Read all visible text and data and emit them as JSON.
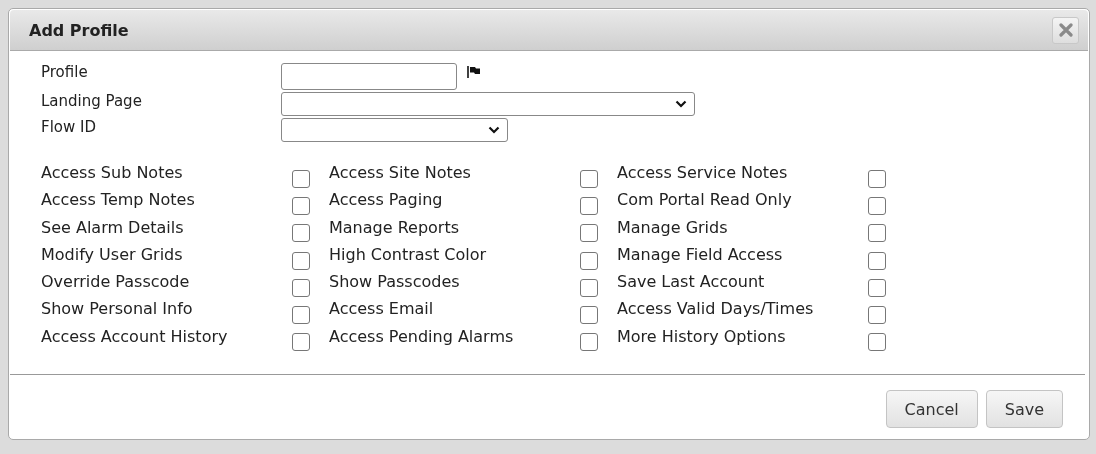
{
  "dialog": {
    "title": "Add Profile"
  },
  "fields": [
    {
      "label": "Profile",
      "kind": "text",
      "flag": true
    },
    {
      "label": "Landing Page",
      "kind": "select"
    },
    {
      "label": "Flow ID",
      "kind": "select"
    }
  ],
  "permissions": [
    {
      "label": "Access Sub Notes",
      "checked": false
    },
    {
      "label": "Access Site Notes",
      "checked": false
    },
    {
      "label": "Access Service Notes",
      "checked": false
    },
    {
      "label": "Access Temp Notes",
      "checked": false
    },
    {
      "label": "Access Paging",
      "checked": false
    },
    {
      "label": "Com Portal Read Only",
      "checked": false
    },
    {
      "label": "See Alarm Details",
      "checked": false
    },
    {
      "label": "Manage Reports",
      "checked": false
    },
    {
      "label": "Manage Grids",
      "checked": false
    },
    {
      "label": "Modify User Grids",
      "checked": false
    },
    {
      "label": "High Contrast Color",
      "checked": false
    },
    {
      "label": "Manage Field Access",
      "checked": false
    },
    {
      "label": "Override Passcode",
      "checked": false
    },
    {
      "label": "Show Passcodes",
      "checked": false
    },
    {
      "label": "Save Last Account",
      "checked": false
    },
    {
      "label": "Show Personal Info",
      "checked": false
    },
    {
      "label": "Access Email",
      "checked": false
    },
    {
      "label": "Access Valid Days/Times",
      "checked": false
    },
    {
      "label": "Access Account History",
      "checked": false
    },
    {
      "label": "Access Pending Alarms",
      "checked": false
    },
    {
      "label": "More History Options",
      "checked": false
    }
  ],
  "buttons": [
    "Cancel",
    "Save"
  ]
}
